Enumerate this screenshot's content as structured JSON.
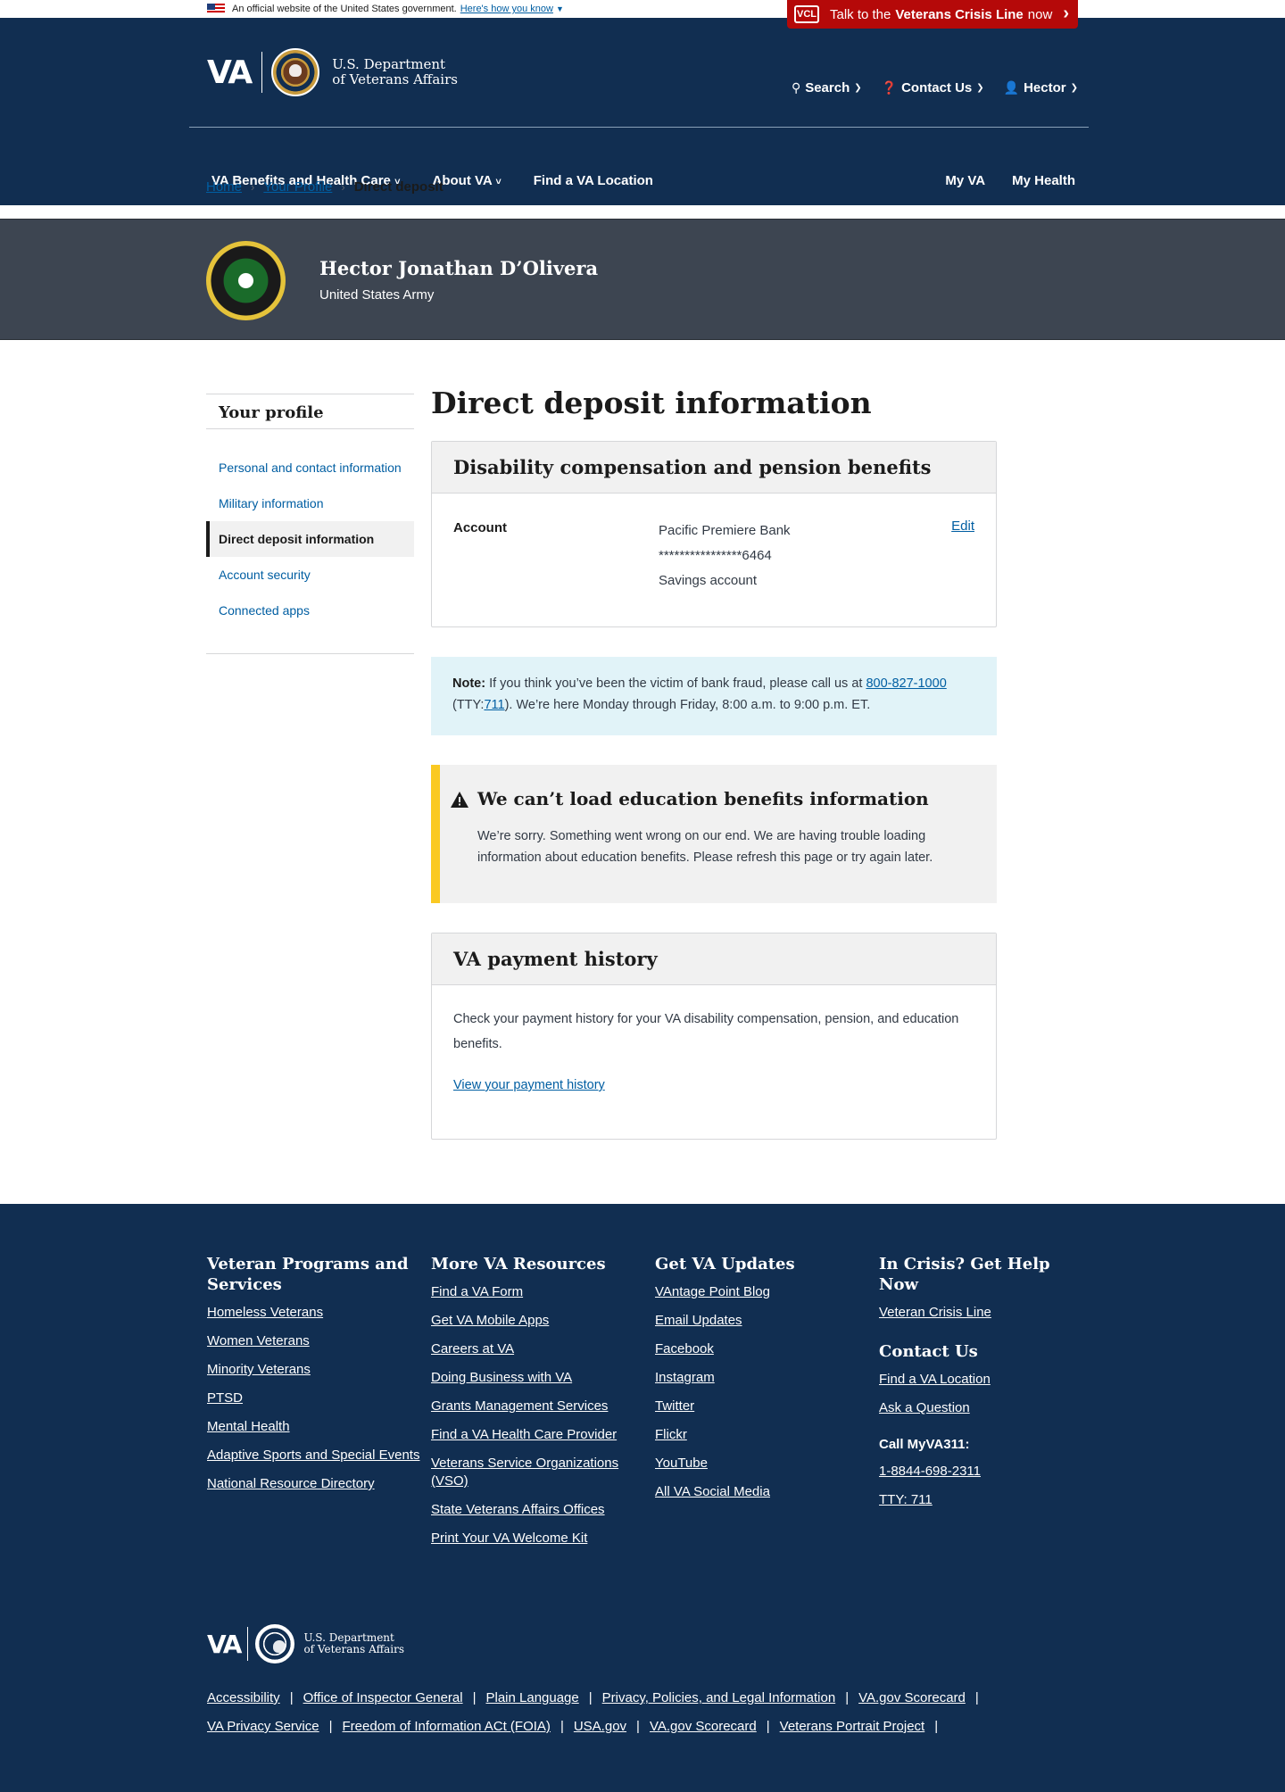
{
  "gov_banner": {
    "text": "An official website of the United States government.",
    "link": "Here's how you know"
  },
  "crisis": {
    "prefix": "Talk to the",
    "bold": "Veterans Crisis Line",
    "suffix": "now"
  },
  "header": {
    "logo": "VA",
    "dept_line1": "U.S. Department",
    "dept_line2": "of Veterans Affairs",
    "search": "Search",
    "contact": "Contact Us",
    "user": "Hector"
  },
  "nav": {
    "benefits": "VA Benefits and Health Care",
    "about": "About VA",
    "find": "Find a VA Location",
    "my_va": "My VA",
    "my_health": "My Health"
  },
  "breadcrumb": [
    "Home",
    "Your Profile",
    "Direct deposit"
  ],
  "profile": {
    "name": "Hector Jonathan D’Olivera",
    "branch": "United States Army"
  },
  "sidenav": {
    "title": "Your profile",
    "items": [
      "Personal and contact information",
      "Military information",
      "Direct deposit information",
      "Account security",
      "Connected apps"
    ],
    "active_index": 2
  },
  "main": {
    "title": "Direct deposit information",
    "comp_card": {
      "title": "Disability compensation and pension benefits",
      "label": "Account",
      "bank": "Pacific Premiere Bank",
      "account_number": "****************6464",
      "account_type": "Savings account",
      "edit": "Edit"
    },
    "note": {
      "label": "Note:",
      "text1": "If you think you’ve been the victim of bank fraud, please call us at",
      "phone": "800-827-1000",
      "text2": "(TTY:",
      "tty": "711",
      "text3": "). We’re here Monday through Friday, 8:00 a.m. to 9:00 p.m. ET."
    },
    "alert": {
      "title": "We can’t load education benefits information",
      "body": "We’re sorry. Something went wrong on our end. We are having trouble loading information about education benefits. Please refresh this page or try again later."
    },
    "payment": {
      "title": "VA payment history",
      "body": "Check your payment history for your VA disability compensation, pension, and education benefits.",
      "link": "View your payment history"
    }
  },
  "footer": {
    "col1": {
      "title": "Veteran Programs and Services",
      "links": [
        "Homeless Veterans",
        "Women Veterans",
        "Minority Veterans",
        "PTSD",
        "Mental Health",
        "Adaptive Sports and Special Events",
        "National Resource Directory"
      ]
    },
    "col2": {
      "title": "More VA Resources",
      "links": [
        "Find a VA Form",
        "Get VA Mobile Apps",
        "Careers at VA",
        "Doing Business with VA",
        "Grants Management Services",
        "Find a VA Health Care Provider",
        "Veterans Service Organizations (VSO)",
        "State Veterans Affairs Offices",
        "Print Your VA Welcome Kit"
      ]
    },
    "col3": {
      "title": "Get VA Updates",
      "links": [
        "VAntage Point Blog",
        "Email Updates",
        "Facebook",
        "Instagram",
        "Twitter",
        "Flickr",
        "YouTube",
        "All VA Social Media"
      ]
    },
    "col4": {
      "title": "In Crisis? Get Help Now",
      "crisis_link": "Veteran Crisis Line",
      "contact_title": "Contact Us",
      "contact_links": [
        "Find a VA Location",
        "Ask a Question"
      ],
      "call_label": "Call MyVA311:",
      "phone": "1-8844-698-2311",
      "tty": "TTY: 711"
    },
    "bottom_row1": [
      "Accessibility",
      "Office of Inspector General",
      "Plain Language",
      "Privacy, Policies, and Legal Information",
      "VA.gov Scorecard"
    ],
    "bottom_row2": [
      "VA Privacy Service",
      "Freedom of Information ACt (FOIA)",
      "USA.gov",
      "VA.gov Scorecard",
      "Veterans Portrait Project"
    ]
  }
}
